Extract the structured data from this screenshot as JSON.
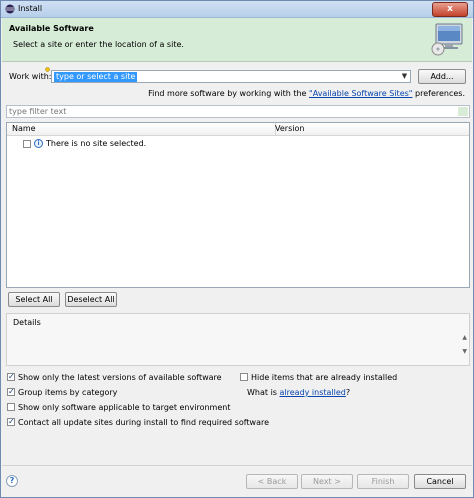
{
  "window": {
    "title": "Install",
    "close_label": "x"
  },
  "header": {
    "title": "Available Software",
    "description": "Select a site or enter the location of a site."
  },
  "work_with": {
    "label": "Work with:",
    "placeholder": "type or select a site",
    "add_button": "Add..."
  },
  "more_software": {
    "prefix": "Find more software by working with the ",
    "link": "\"Available Software Sites\"",
    "suffix": " preferences."
  },
  "filter": {
    "placeholder": "type filter text"
  },
  "table": {
    "columns": [
      "Name",
      "Version"
    ],
    "rows": [
      {
        "name": "There is no site selected.",
        "version": ""
      }
    ]
  },
  "selection_buttons": {
    "select_all": "Select All",
    "deselect_all": "Deselect All"
  },
  "details": {
    "title": "Details"
  },
  "options": {
    "latest_versions": {
      "label": "Show only the latest versions of available software",
      "checked": true
    },
    "group_by_category": {
      "label": "Group items by category",
      "checked": true
    },
    "target_env": {
      "label": "Show only software applicable to target environment",
      "checked": false
    },
    "contact_sites": {
      "label": "Contact all update sites during install to find required software",
      "checked": true
    },
    "hide_installed": {
      "label": "Hide items that are already installed",
      "checked": false
    },
    "what_is_prefix": "What is ",
    "already_installed_link": "already installed",
    "what_is_suffix": "?"
  },
  "footer": {
    "help": "?",
    "back": "< Back",
    "next": "Next >",
    "finish": "Finish",
    "cancel": "Cancel"
  },
  "colors": {
    "header_bg": "#d6ecd6",
    "selection": "#3399ff",
    "link": "#0645ad"
  }
}
